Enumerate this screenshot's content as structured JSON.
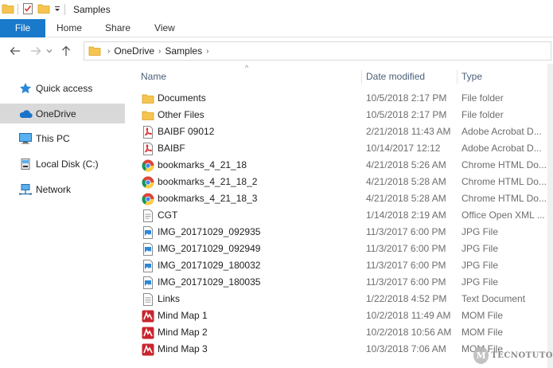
{
  "window": {
    "title": "Samples"
  },
  "ribbon": {
    "tabs": [
      "File",
      "Home",
      "Share",
      "View"
    ]
  },
  "address": {
    "crumbs": [
      "OneDrive",
      "Samples"
    ]
  },
  "navpane": {
    "items": [
      {
        "label": "Quick access",
        "icon": "star-icon"
      },
      {
        "label": "OneDrive",
        "icon": "cloud-icon",
        "selected": true
      },
      {
        "label": "This PC",
        "icon": "computer-icon"
      },
      {
        "label": "Local Disk (C:)",
        "icon": "drive-icon"
      },
      {
        "label": "Network",
        "icon": "network-icon"
      }
    ]
  },
  "list": {
    "columns": {
      "name": "Name",
      "date": "Date modified",
      "type": "Type"
    },
    "rows": [
      {
        "name": "Documents",
        "date": "10/5/2018 2:17 PM",
        "type": "File folder",
        "icon": "folder"
      },
      {
        "name": "Other Files",
        "date": "10/5/2018 2:17 PM",
        "type": "File folder",
        "icon": "folder"
      },
      {
        "name": "BAIBF 09012",
        "date": "2/21/2018 11:43 AM",
        "type": "Adobe Acrobat D...",
        "icon": "pdf"
      },
      {
        "name": "BAIBF",
        "date": "10/14/2017 12:12",
        "type": "Adobe Acrobat D...",
        "icon": "pdf"
      },
      {
        "name": "bookmarks_4_21_18",
        "date": "4/21/2018 5:26 AM",
        "type": "Chrome HTML Do...",
        "icon": "chrome"
      },
      {
        "name": "bookmarks_4_21_18_2",
        "date": "4/21/2018 5:28 AM",
        "type": "Chrome HTML Do...",
        "icon": "chrome"
      },
      {
        "name": "bookmarks_4_21_18_3",
        "date": "4/21/2018 5:28 AM",
        "type": "Chrome HTML Do...",
        "icon": "chrome"
      },
      {
        "name": "CGT",
        "date": "1/14/2018 2:19 AM",
        "type": "Office Open XML ...",
        "icon": "doc"
      },
      {
        "name": "IMG_20171029_092935",
        "date": "11/3/2017 6:00 PM",
        "type": "JPG File",
        "icon": "image"
      },
      {
        "name": "IMG_20171029_092949",
        "date": "11/3/2017 6:00 PM",
        "type": "JPG File",
        "icon": "image"
      },
      {
        "name": "IMG_20171029_180032",
        "date": "11/3/2017 6:00 PM",
        "type": "JPG File",
        "icon": "image"
      },
      {
        "name": "IMG_20171029_180035",
        "date": "11/3/2017 6:00 PM",
        "type": "JPG File",
        "icon": "image"
      },
      {
        "name": "Links",
        "date": "1/22/2018 4:52 PM",
        "type": "Text Document",
        "icon": "text"
      },
      {
        "name": "Mind Map 1",
        "date": "10/2/2018 11:49 AM",
        "type": "MOM File",
        "icon": "mindmap"
      },
      {
        "name": "Mind Map 2",
        "date": "10/2/2018 10:56 AM",
        "type": "MOM File",
        "icon": "mindmap"
      },
      {
        "name": "Mind Map 3",
        "date": "10/3/2018 7:06 AM",
        "type": "MOM File",
        "icon": "mindmap"
      }
    ]
  },
  "watermark": {
    "logo": "M",
    "text": "TECNOTUTO"
  },
  "colors": {
    "file_tab": "#1979ca",
    "selected_nav": "#d9d9d9",
    "folder": "#f5c451",
    "pdf": "#d9302c",
    "header_text": "#4c607a"
  }
}
